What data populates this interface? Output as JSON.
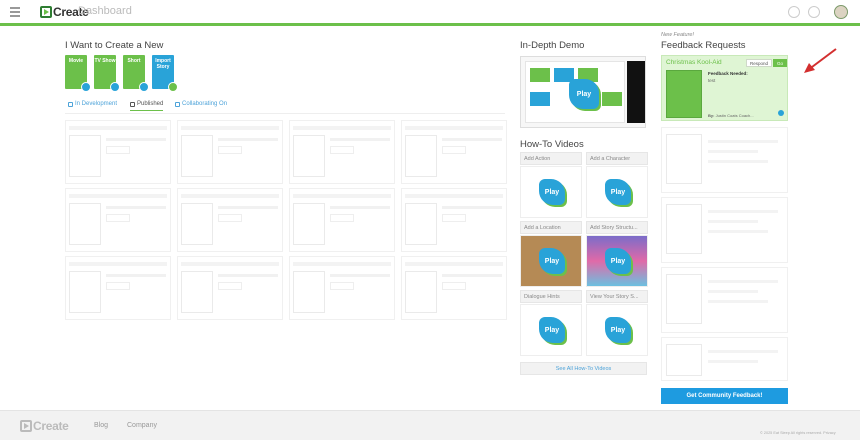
{
  "header": {
    "logo_text": "Create",
    "page_title": "Dashboard"
  },
  "create_section": {
    "title": "I Want to Create a New",
    "tiles": [
      {
        "label": "Movie"
      },
      {
        "label": "TV Show"
      },
      {
        "label": "Short"
      },
      {
        "label": "Import Story"
      }
    ]
  },
  "tabs": [
    {
      "label": "In Development"
    },
    {
      "label": "Published"
    },
    {
      "label": "Collaborating On"
    }
  ],
  "demo": {
    "title": "In-Depth Demo",
    "play_label": "Play"
  },
  "howto": {
    "title": "How-To Videos",
    "videos": [
      {
        "label": "Add Action"
      },
      {
        "label": "Add a Character"
      },
      {
        "label": "Add a Location"
      },
      {
        "label": "Add Story Structu..."
      },
      {
        "label": "Dialogue Hints"
      },
      {
        "label": "View Your Story S..."
      }
    ],
    "see_all": "See All How-To Videos"
  },
  "feedback": {
    "new_feature": "New Feature!",
    "title": "Feedback Requests",
    "main": {
      "title": "Christmas Kool-Aid",
      "btn_respond": "Respond",
      "btn_go": "Go",
      "feedback_needed": "Feedback Needed:",
      "text": "test",
      "by_label": "By:",
      "authors": "Justin Coats   Coach..."
    },
    "cta": "Get Community Feedback!"
  },
  "footer": {
    "links": [
      "Blog",
      "Company"
    ],
    "copyright": "© 2025 Eat Sleep All rights reserved.   Privacy"
  },
  "colors": {
    "brand_green": "#6cc04a",
    "brand_blue": "#29a3d8",
    "cta_blue": "#1e9be0"
  }
}
